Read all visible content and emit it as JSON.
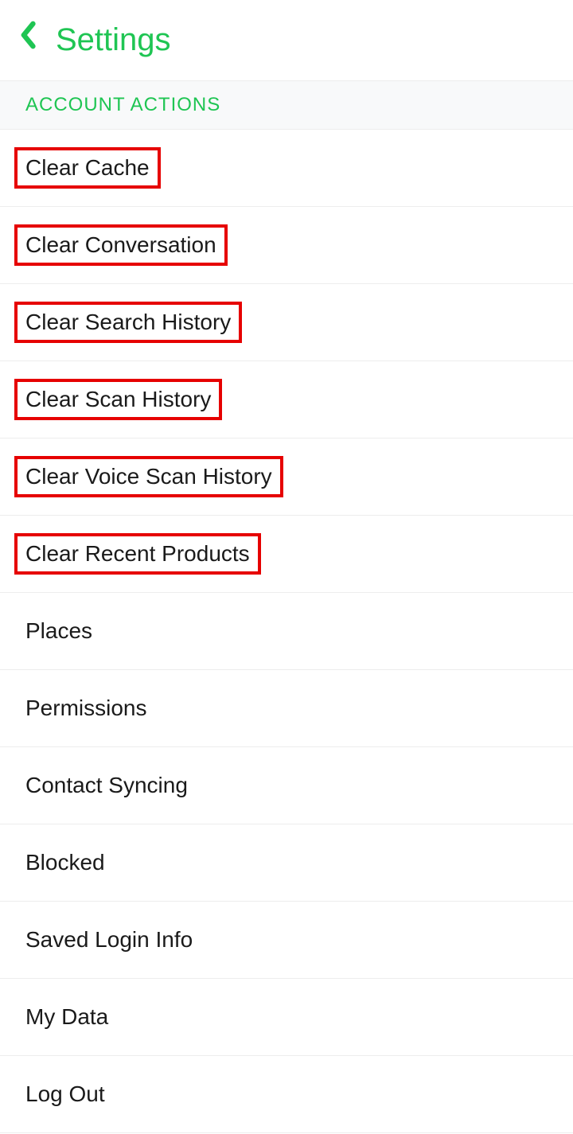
{
  "header": {
    "title": "Settings"
  },
  "section": {
    "title": "ACCOUNT ACTIONS"
  },
  "items": [
    {
      "label": "Clear Cache",
      "highlighted": true
    },
    {
      "label": "Clear Conversation",
      "highlighted": true
    },
    {
      "label": "Clear Search History",
      "highlighted": true
    },
    {
      "label": "Clear Scan History",
      "highlighted": true
    },
    {
      "label": "Clear Voice Scan History",
      "highlighted": true
    },
    {
      "label": "Clear Recent Products",
      "highlighted": true
    },
    {
      "label": "Places",
      "highlighted": false
    },
    {
      "label": "Permissions",
      "highlighted": false
    },
    {
      "label": "Contact Syncing",
      "highlighted": false
    },
    {
      "label": "Blocked",
      "highlighted": false
    },
    {
      "label": "Saved Login Info",
      "highlighted": false
    },
    {
      "label": "My Data",
      "highlighted": false
    },
    {
      "label": "Log Out",
      "highlighted": false
    }
  ]
}
